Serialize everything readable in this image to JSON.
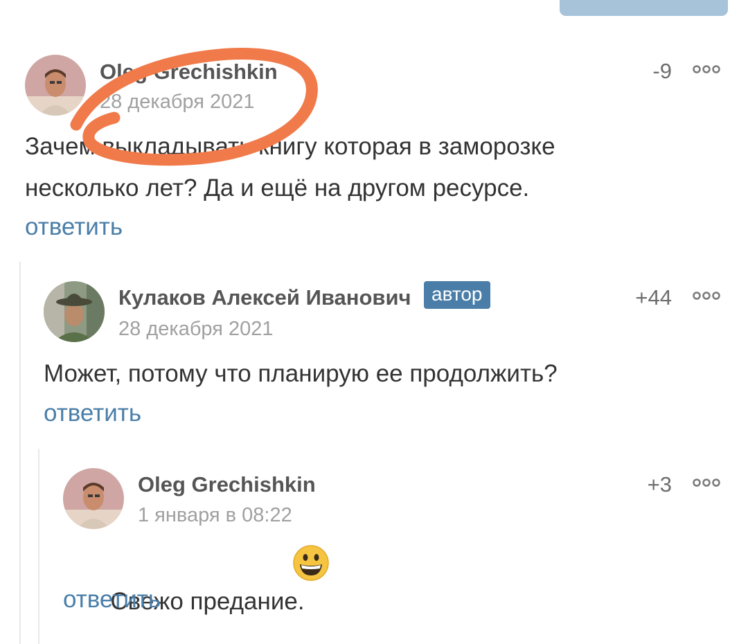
{
  "comments": [
    {
      "author": "Oleg Grechishkin",
      "date": "28 декабря 2021",
      "score": "-9",
      "text_lines": [
        "Зачем выкладывать книгу которая в заморозке",
        "несколько лет?  Да и ещё на другом ресурсе."
      ],
      "reply_label": "ответить",
      "avatar": "user-photo"
    },
    {
      "author": "Кулаков Алексей Иванович",
      "badge": "автор",
      "date": "28 декабря 2021",
      "score": "+44",
      "text_lines": [
        "Может, потому что планирую ее продолжить?"
      ],
      "reply_label": "ответить",
      "avatar": "user-photo-hat"
    },
    {
      "author": "Oleg Grechishkin",
      "date": "1 января в 08:22",
      "score": "+3",
      "text_lines": [
        "Свежо предание. "
      ],
      "emoji": "grinning-face-emoji",
      "reply_label": "ответить",
      "avatar": "user-photo"
    }
  ],
  "more_icon": "more-dots-icon",
  "colors": {
    "link": "#4a7ea8",
    "badge": "#4a7ea8",
    "annotation": "#f07a4a",
    "top_button": "#a7c3da"
  }
}
